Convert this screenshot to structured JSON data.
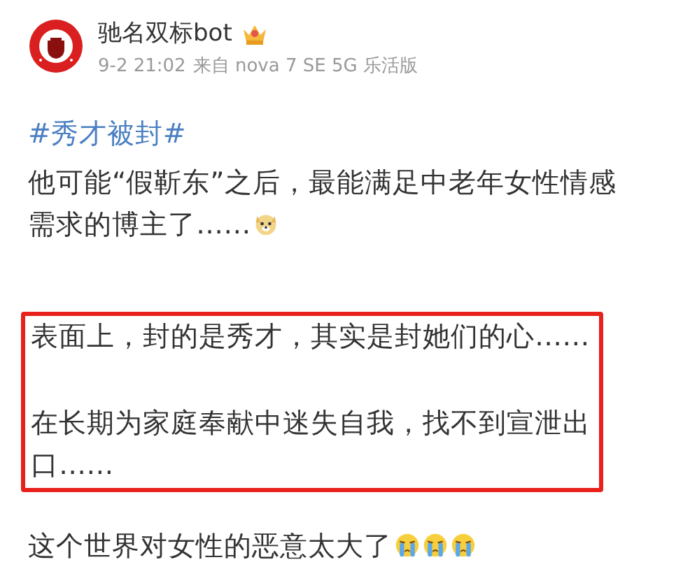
{
  "post": {
    "author": {
      "name": "驰名双标bot",
      "crowned": true
    },
    "meta": {
      "time": "9-2 21:02",
      "source": "来自 nova 7 SE 5G 乐活版"
    },
    "blocks": [
      {
        "kind": "hashtag",
        "text": "#秀才被封#"
      },
      {
        "kind": "paragraph",
        "text": "他可能“假靳东”之后，最能满足中老年女性情感需求的博主了……",
        "emojis": [
          {
            "kind": "doge"
          }
        ]
      },
      {
        "kind": "boxed",
        "paragraphs": [
          {
            "text": "表面上，封的是秀才，其实是封她们的心……"
          },
          {
            "text": "在长期为家庭奉献中迷失自我，找不到宣泄出口……"
          }
        ]
      },
      {
        "kind": "paragraph",
        "text": "这个世界对女性的恶意太大了",
        "emojis": [
          {
            "kind": "crying"
          },
          {
            "kind": "crying"
          },
          {
            "kind": "crying"
          }
        ]
      }
    ]
  }
}
